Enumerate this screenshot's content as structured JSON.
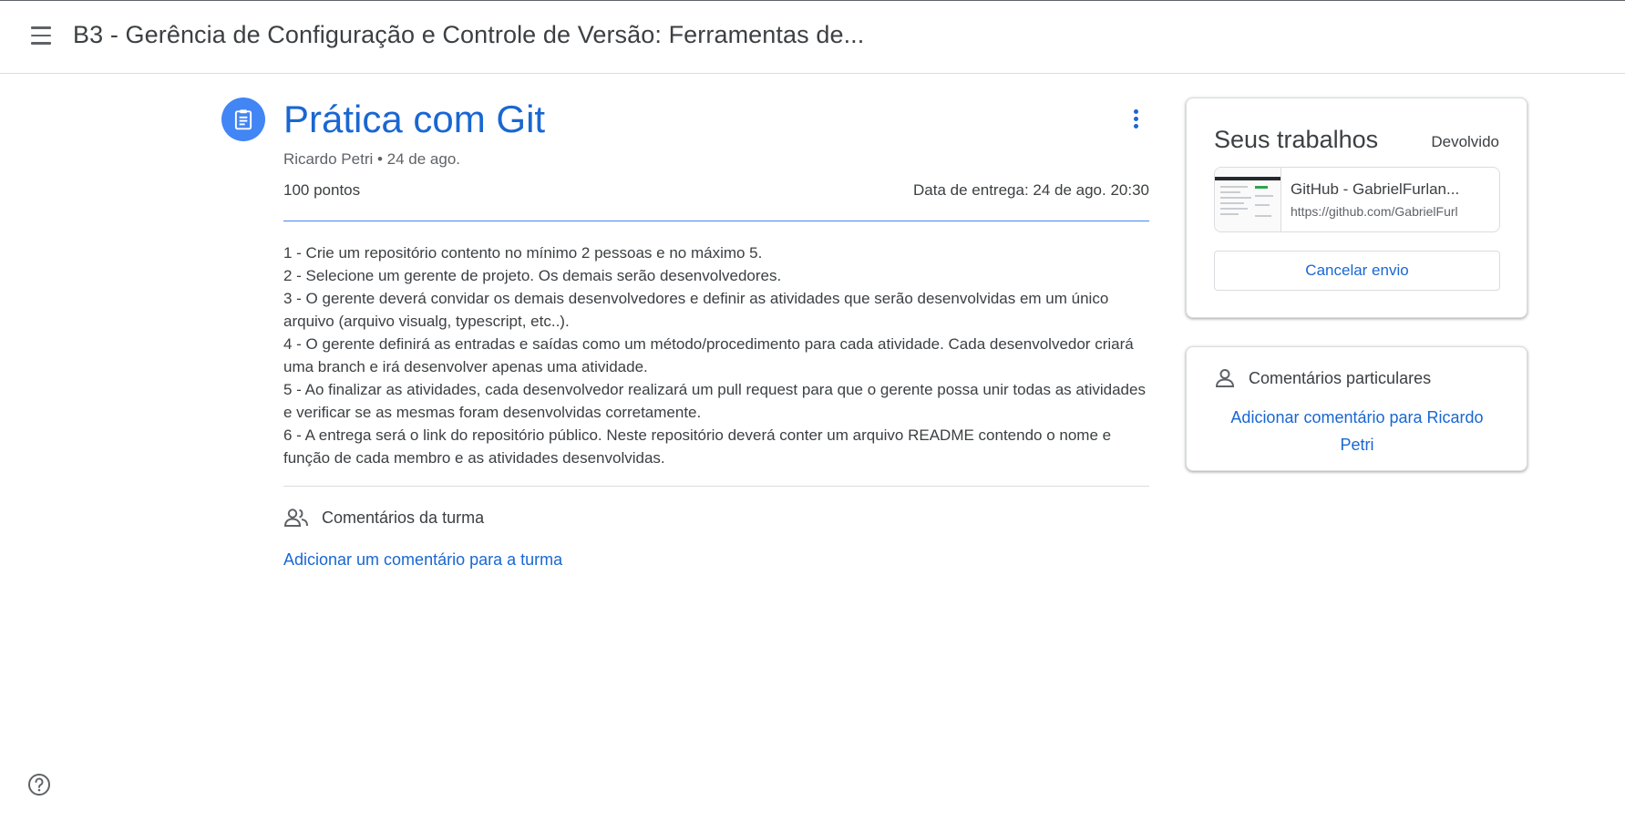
{
  "header": {
    "course_title": "B3 - Gerência de Configuração e Controle de Versão: Ferramentas de..."
  },
  "assignment": {
    "title": "Prática com Git",
    "author_date": "Ricardo Petri • 24 de ago.",
    "points": "100 pontos",
    "due": "Data de entrega: 24 de ago. 20:30",
    "description": [
      "1 - Crie um repositório contento no mínimo 2 pessoas e no máximo 5.",
      "2 - Selecione um gerente de projeto. Os demais serão desenvolvedores.",
      "3 - O gerente deverá convidar os demais desenvolvedores e definir as atividades que serão desenvolvidas em um único arquivo (arquivo visualg, typescript, etc..).",
      "4 - O gerente definirá as entradas e saídas como um método/procedimento para cada atividade. Cada desenvolvedor criará uma branch e irá desenvolver apenas uma atividade.",
      "5 - Ao finalizar as atividades, cada desenvolvedor realizará um pull request para que o gerente possa unir todas as atividades e verificar se as mesmas foram desenvolvidas corretamente.",
      "6 - A entrega será o link do repositório público. Neste repositório deverá conter um arquivo README contendo o nome e função de cada membro e as atividades desenvolvidas."
    ]
  },
  "class_comments": {
    "heading": "Comentários da turma",
    "add_link": "Adicionar um comentário para a turma"
  },
  "your_work": {
    "title": "Seus trabalhos",
    "status": "Devolvido",
    "attachment": {
      "title": "GitHub - GabrielFurlan...",
      "url": "https://github.com/GabrielFurl"
    },
    "cancel_label": "Cancelar envio"
  },
  "private_comments": {
    "heading": "Comentários particulares",
    "add_link": "Adicionar comentário para Ricardo Petri"
  },
  "colors": {
    "accent": "#1967d2",
    "icon_bg": "#4285f4"
  }
}
